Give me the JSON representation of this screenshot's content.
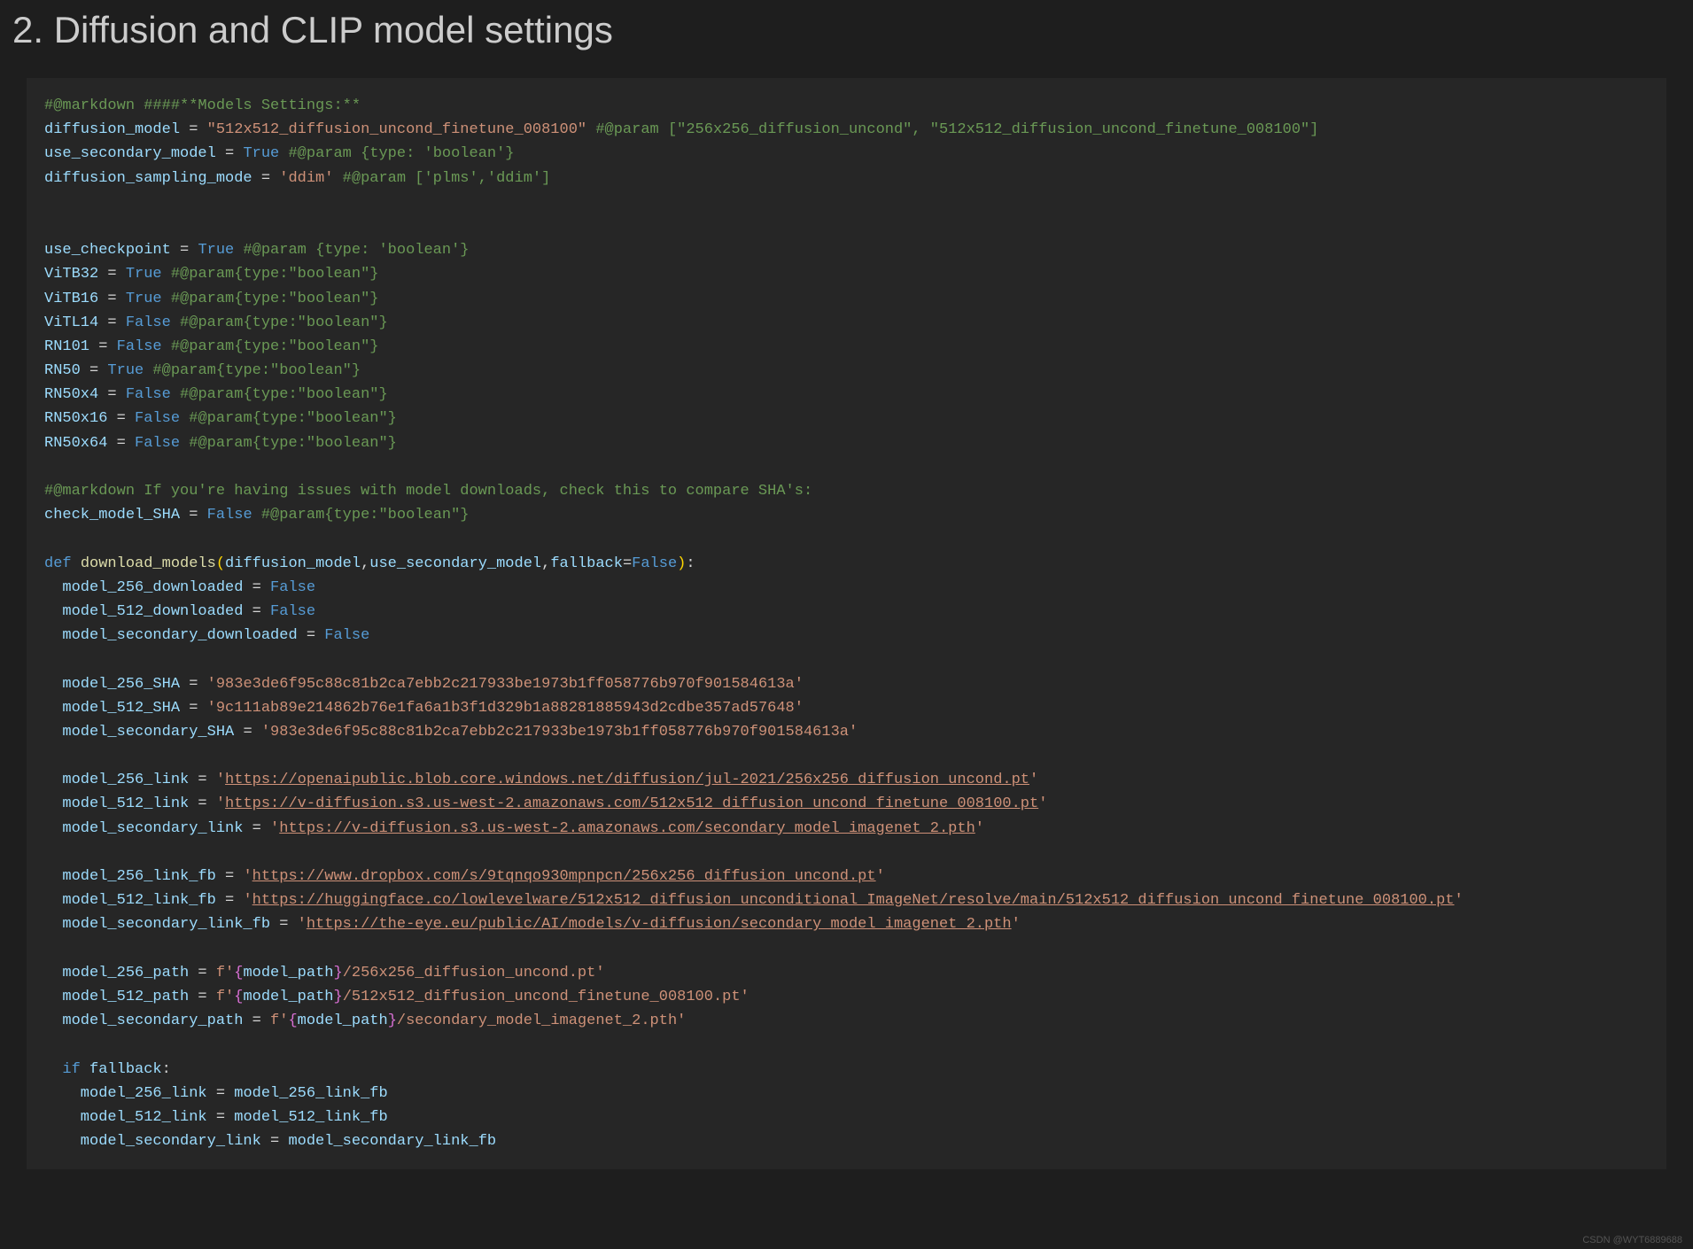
{
  "heading": "2. Diffusion and CLIP model settings",
  "watermark": "CSDN @WYT6889688",
  "code": {
    "l1_comment": "#@markdown ####**Models Settings:**",
    "l2_var": "diffusion_model",
    "l2_eq": " = ",
    "l2_str": "\"512x512_diffusion_uncond_finetune_008100\"",
    "l2_tail": " #@param [\"256x256_diffusion_uncond\", \"512x512_diffusion_uncond_finetune_008100\"]",
    "l3_var": "use_secondary_model",
    "l3_eq": " = ",
    "l3_bool": "True",
    "l3_tail": " #@param {type: 'boolean'}",
    "l4_var": "diffusion_sampling_mode",
    "l4_eq": " = ",
    "l4_str": "'ddim'",
    "l4_tail": " #@param ['plms','ddim']",
    "l6_var": "use_checkpoint",
    "l6_eq": " = ",
    "l6_bool": "True",
    "l6_tail": " #@param {type: 'boolean'}",
    "l7_var": "ViTB32",
    "l7_eq": " = ",
    "l7_bool": "True",
    "l7_tail": " #@param{type:\"boolean\"}",
    "l8_var": "ViTB16",
    "l8_eq": " = ",
    "l8_bool": "True",
    "l8_tail": " #@param{type:\"boolean\"}",
    "l9_var": "ViTL14",
    "l9_eq": " = ",
    "l9_bool": "False",
    "l9_tail": " #@param{type:\"boolean\"}",
    "l10_var": "RN101",
    "l10_eq": " = ",
    "l10_bool": "False",
    "l10_tail": " #@param{type:\"boolean\"}",
    "l11_var": "RN50",
    "l11_eq": " = ",
    "l11_bool": "True",
    "l11_tail": " #@param{type:\"boolean\"}",
    "l12_var": "RN50x4",
    "l12_eq": " = ",
    "l12_bool": "False",
    "l12_tail": " #@param{type:\"boolean\"}",
    "l13_var": "RN50x16",
    "l13_eq": " = ",
    "l13_bool": "False",
    "l13_tail": " #@param{type:\"boolean\"}",
    "l14_var": "RN50x64",
    "l14_eq": " = ",
    "l14_bool": "False",
    "l14_tail": " #@param{type:\"boolean\"}",
    "l16_comment": "#@markdown If you're having issues with model downloads, check this to compare SHA's:",
    "l17_var": "check_model_SHA",
    "l17_eq": " = ",
    "l17_bool": "False",
    "l17_tail": " #@param{type:\"boolean\"}",
    "l19_def": "def ",
    "l19_func": "download_models",
    "l19_po": "(",
    "l19_p1": "diffusion_model",
    "l19_c1": ",",
    "l19_p2": "use_secondary_model",
    "l19_c2": ",",
    "l19_p3": "fallback",
    "l19_eq": "=",
    "l19_b": "False",
    "l19_pc": ")",
    "l19_colon": ":",
    "l20_var": "  model_256_downloaded",
    "l20_eq": " = ",
    "l20_bool": "False",
    "l21_var": "  model_512_downloaded",
    "l21_eq": " = ",
    "l21_bool": "False",
    "l22_var": "  model_secondary_downloaded",
    "l22_eq": " = ",
    "l22_bool": "False",
    "l24_var": "  model_256_SHA",
    "l24_eq": " = ",
    "l24_str": "'983e3de6f95c88c81b2ca7ebb2c217933be1973b1ff058776b970f901584613a'",
    "l25_var": "  model_512_SHA",
    "l25_eq": " = ",
    "l25_str": "'9c111ab89e214862b76e1fa6a1b3f1d329b1a88281885943d2cdbe357ad57648'",
    "l26_var": "  model_secondary_SHA",
    "l26_eq": " = ",
    "l26_str": "'983e3de6f95c88c81b2ca7ebb2c217933be1973b1ff058776b970f901584613a'",
    "l28_var": "  model_256_link",
    "l28_eq": " = ",
    "l28_q": "'",
    "l28_url": "https://openaipublic.blob.core.windows.net/diffusion/jul-2021/256x256_diffusion_uncond.pt",
    "l28_q2": "'",
    "l29_var": "  model_512_link",
    "l29_eq": " = ",
    "l29_q": "'",
    "l29_url": "https://v-diffusion.s3.us-west-2.amazonaws.com/512x512_diffusion_uncond_finetune_008100.pt",
    "l29_q2": "'",
    "l30_var": "  model_secondary_link",
    "l30_eq": " = ",
    "l30_q": "'",
    "l30_url": "https://v-diffusion.s3.us-west-2.amazonaws.com/secondary_model_imagenet_2.pth",
    "l30_q2": "'",
    "l32_var": "  model_256_link_fb",
    "l32_eq": " = ",
    "l32_q": "'",
    "l32_url": "https://www.dropbox.com/s/9tqnqo930mpnpcn/256x256_diffusion_uncond.pt",
    "l32_q2": "'",
    "l33_var": "  model_512_link_fb",
    "l33_eq": " = ",
    "l33_q": "'",
    "l33_url": "https://huggingface.co/lowlevelware/512x512_diffusion_unconditional_ImageNet/resolve/main/512x512_diffusion_uncond_finetune_008100.pt",
    "l33_q2": "'",
    "l34_var": "  model_secondary_link_fb",
    "l34_eq": " = ",
    "l34_q": "'",
    "l34_url": "https://the-eye.eu/public/AI/models/v-diffusion/secondary_model_imagenet_2.pth",
    "l34_q2": "'",
    "l36_var": "  model_256_path",
    "l36_eq": " = ",
    "l36_f": "f'",
    "l36_bo": "{",
    "l36_mp": "model_path",
    "l36_bc": "}",
    "l36_s": "/256x256_diffusion_uncond.pt'",
    "l37_var": "  model_512_path",
    "l37_eq": " = ",
    "l37_f": "f'",
    "l37_bo": "{",
    "l37_mp": "model_path",
    "l37_bc": "}",
    "l37_s": "/512x512_diffusion_uncond_finetune_008100.pt'",
    "l38_var": "  model_secondary_path",
    "l38_eq": " = ",
    "l38_f": "f'",
    "l38_bo": "{",
    "l38_mp": "model_path",
    "l38_bc": "}",
    "l38_s": "/secondary_model_imagenet_2.pth'",
    "l40_if": "  if",
    "l40_cond": " fallback",
    "l40_colon": ":",
    "l41_var": "    model_256_link",
    "l41_eq": " = ",
    "l41_rhs": "model_256_link_fb",
    "l42_var": "    model_512_link",
    "l42_eq": " = ",
    "l42_rhs": "model_512_link_fb",
    "l43_var": "    model_secondary_link",
    "l43_eq": " = ",
    "l43_rhs": "model_secondary_link_fb"
  }
}
